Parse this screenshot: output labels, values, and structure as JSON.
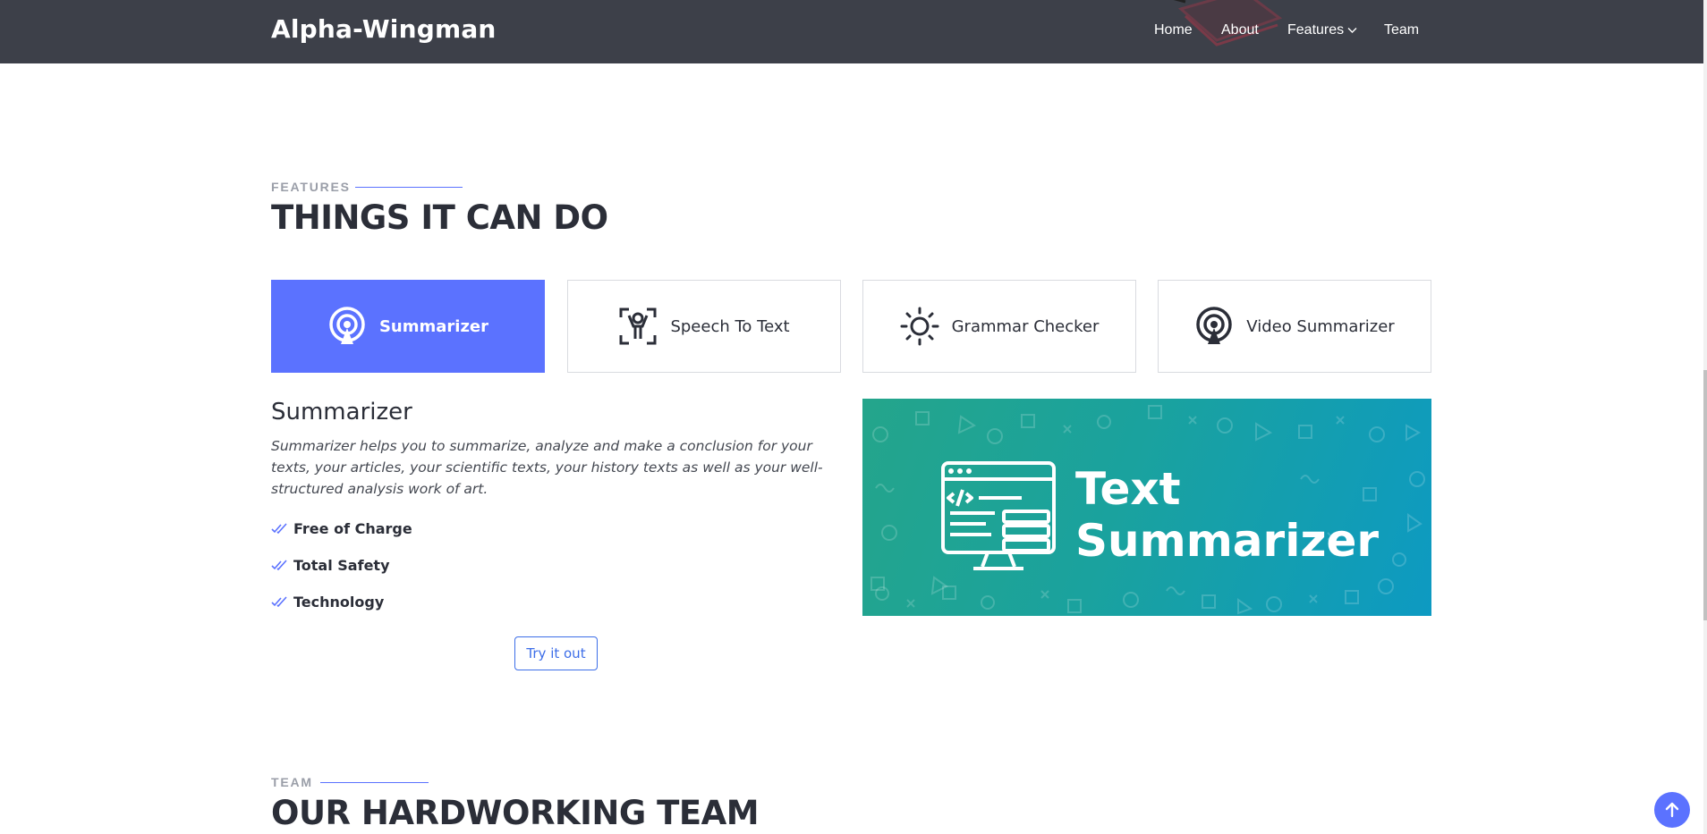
{
  "header": {
    "logo": "Alpha-Wingman",
    "nav": [
      {
        "label": "Home"
      },
      {
        "label": "About"
      },
      {
        "label": "Features"
      },
      {
        "label": "Team"
      }
    ]
  },
  "features": {
    "section_label": "FEATURES",
    "title": "THINGS IT CAN DO",
    "tabs": [
      {
        "label": "Summarizer",
        "icon": "podcast-icon",
        "active": true
      },
      {
        "label": "Speech To Text",
        "icon": "person-scan-icon",
        "active": false
      },
      {
        "label": "Grammar Checker",
        "icon": "sun-icon",
        "active": false
      },
      {
        "label": "Video Summarizer",
        "icon": "podcast-icon",
        "active": false
      }
    ],
    "content": {
      "title": "Summarizer",
      "description": "Summarizer helps you to summarize, analyze and make a conclusion for your texts, your articles, your scientific texts, your history texts as well as your well-structured analysis work of art.",
      "checklist": [
        "Free of Charge",
        "Total Safety",
        "Technology"
      ],
      "button": "Try it out"
    },
    "banner": {
      "line1": "Text",
      "line2": "Summarizer"
    }
  },
  "team": {
    "section_label": "TEAM",
    "title": "OUR HARDWORKING TEAM"
  },
  "colors": {
    "accent": "#5b72ff",
    "header_bg": "#3d4049",
    "banner_start": "#24a58b",
    "banner_end": "#0d9ac2"
  }
}
